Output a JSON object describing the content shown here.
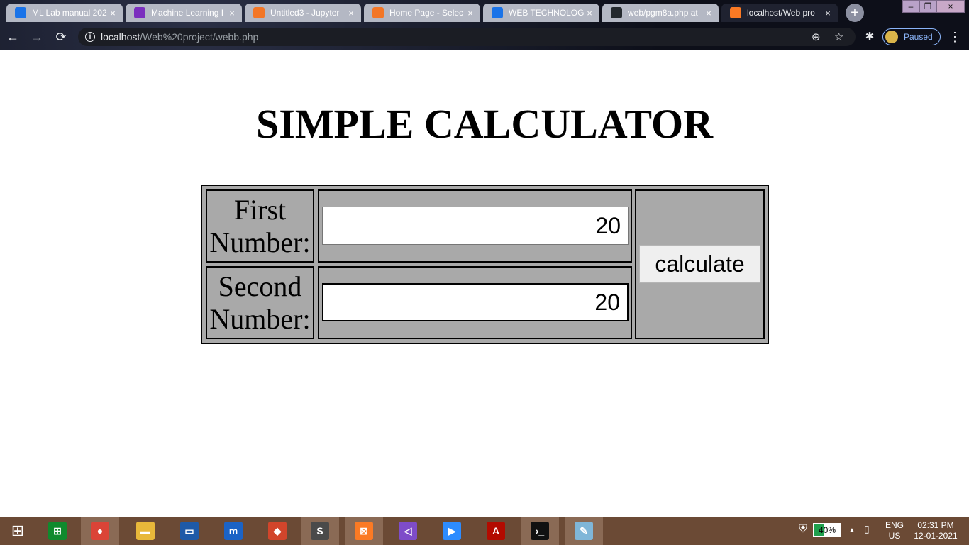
{
  "browser": {
    "tabs": [
      {
        "title": "ML Lab manual 202",
        "icon_color": "#1a73e8",
        "icon": "classroom-icon",
        "active": false
      },
      {
        "title": "Machine Learning I",
        "icon_color": "#7b2fbe",
        "icon": "classroom-icon",
        "active": false
      },
      {
        "title": "Untitled3 - Jupyter",
        "icon_color": "#f37626",
        "icon": "jupyter-icon",
        "active": false
      },
      {
        "title": "Home Page - Selec",
        "icon_color": "#f37626",
        "icon": "loading-icon",
        "active": false
      },
      {
        "title": "WEB TECHNOLOGI",
        "icon_color": "#1a73e8",
        "icon": "classroom-icon",
        "active": false
      },
      {
        "title": "web/pgm8a.php at",
        "icon_color": "#24292e",
        "icon": "github-icon",
        "active": false
      },
      {
        "title": "localhost/Web pro",
        "icon_color": "#fb7a24",
        "icon": "xampp-icon",
        "active": true
      }
    ],
    "close_glyph": "×",
    "new_tab_glyph": "+",
    "window_controls": {
      "minimize": "–",
      "restore": "❐",
      "close": "×"
    },
    "nav": {
      "back": "←",
      "forward": "→",
      "reload": "⟳"
    },
    "address": {
      "host": "localhost",
      "path": "/Web%20project/webb.php"
    },
    "omnibox_icons": {
      "zoom": "⊕",
      "star": "☆",
      "extensions": "✱",
      "menu": "⋮"
    },
    "profile_status": "Paused"
  },
  "page": {
    "title": "SIMPLE CALCULATOR",
    "first_label_line1": "First",
    "first_label_line2": "Number:",
    "second_label_line1": "Second",
    "second_label_line2": "Number:",
    "first_value": "20",
    "second_value": "20",
    "button_label": "calculate"
  },
  "taskbar": {
    "apps": [
      {
        "name": "store-icon",
        "color": "#0f8a2d",
        "glyph": "⊞",
        "active": false
      },
      {
        "name": "chrome-icon",
        "color": "#db4437",
        "glyph": "●",
        "active": true
      },
      {
        "name": "file-explorer-icon",
        "color": "#e8b83a",
        "glyph": "▬",
        "active": false
      },
      {
        "name": "lenovo-icon",
        "color": "#1e5aa8",
        "glyph": "▭",
        "active": false
      },
      {
        "name": "maxthon-icon",
        "color": "#1b63c6",
        "glyph": "m",
        "active": false
      },
      {
        "name": "app-red-icon",
        "color": "#d2452b",
        "glyph": "◆",
        "active": false
      },
      {
        "name": "sublime-icon",
        "color": "#4a4a4a",
        "glyph": "S",
        "active": true
      },
      {
        "name": "xampp-icon",
        "color": "#fb7a24",
        "glyph": "⊠",
        "active": true
      },
      {
        "name": "visual-studio-icon",
        "color": "#7e4cc9",
        "glyph": "◁",
        "active": false
      },
      {
        "name": "zoom-icon",
        "color": "#2d8cff",
        "glyph": "▶",
        "active": false
      },
      {
        "name": "acrobat-icon",
        "color": "#b30b00",
        "glyph": "A",
        "active": false
      },
      {
        "name": "cmd-icon",
        "color": "#111111",
        "glyph": "›_",
        "active": true
      },
      {
        "name": "notepad-icon",
        "color": "#7fb6d8",
        "glyph": "✎",
        "active": true
      }
    ],
    "battery_percent": 40,
    "battery_label": "40%",
    "lang_line1": "ENG",
    "lang_line2": "US",
    "time": "02:31 PM",
    "date": "12-01-2021",
    "start_glyph": "⊞"
  }
}
